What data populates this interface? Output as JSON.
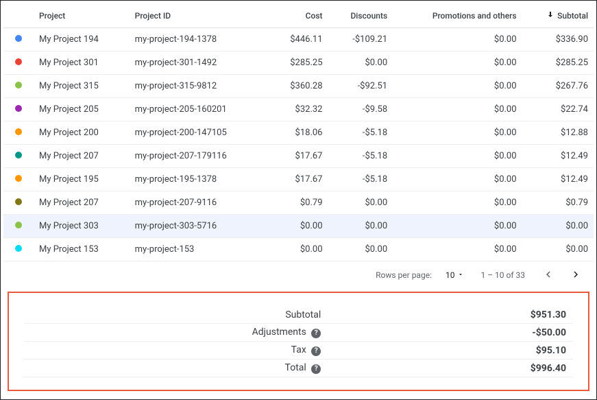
{
  "columns": {
    "project": "Project",
    "project_id": "Project ID",
    "cost": "Cost",
    "discounts": "Discounts",
    "promotions": "Promotions and others",
    "subtotal": "Subtotal"
  },
  "rows": [
    {
      "color": "#4285f4",
      "project": "My Project 194",
      "project_id": "my-project-194-1378",
      "cost": "$446.11",
      "discounts": "-$109.21",
      "promotions": "$0.00",
      "subtotal": "$336.90",
      "highlight": false
    },
    {
      "color": "#ea4335",
      "project": "My Project 301",
      "project_id": "my-project-301-1492",
      "cost": "$285.25",
      "discounts": "$0.00",
      "promotions": "$0.00",
      "subtotal": "$285.25",
      "highlight": false
    },
    {
      "color": "#8bc34a",
      "project": "My Project 315",
      "project_id": "my-project-315-9812",
      "cost": "$360.28",
      "discounts": "-$92.51",
      "promotions": "$0.00",
      "subtotal": "$267.76",
      "highlight": false
    },
    {
      "color": "#9c27b0",
      "project": "My Project 205",
      "project_id": "my-project-205-160201",
      "cost": "$32.32",
      "discounts": "-$9.58",
      "promotions": "$0.00",
      "subtotal": "$22.74",
      "highlight": false
    },
    {
      "color": "#ff9800",
      "project": "My Project 200",
      "project_id": "my-project-200-147105",
      "cost": "$18.06",
      "discounts": "-$5.18",
      "promotions": "$0.00",
      "subtotal": "$12.88",
      "highlight": false
    },
    {
      "color": "#009688",
      "project": "My Project 207",
      "project_id": "my-project-207-179116",
      "cost": "$17.67",
      "discounts": "-$5.18",
      "promotions": "$0.00",
      "subtotal": "$12.49",
      "highlight": false
    },
    {
      "color": "#ff9800",
      "project": "My Project 195",
      "project_id": "my-project-195-1378",
      "cost": "$17.67",
      "discounts": "-$5.18",
      "promotions": "$0.00",
      "subtotal": "$12.49",
      "highlight": false
    },
    {
      "color": "#827717",
      "project": "My Project 207",
      "project_id": "my-project-207-9116",
      "cost": "$0.79",
      "discounts": "$0.00",
      "promotions": "$0.00",
      "subtotal": "$0.79",
      "highlight": false
    },
    {
      "color": "#8bc34a",
      "project": "My Project 303",
      "project_id": "my-project-303-5716",
      "cost": "$0.00",
      "discounts": "$0.00",
      "promotions": "$0.00",
      "subtotal": "$0.00",
      "highlight": true
    },
    {
      "color": "#03dcf4",
      "project": "My Project 153",
      "project_id": "my-project-153",
      "cost": "$0.00",
      "discounts": "$0.00",
      "promotions": "$0.00",
      "subtotal": "$0.00",
      "highlight": false
    }
  ],
  "pagination": {
    "rows_per_page_label": "Rows per page:",
    "page_size": "10",
    "range": "1 – 10 of 33"
  },
  "summary": {
    "subtotal_label": "Subtotal",
    "subtotal_value": "$951.30",
    "adjustments_label": "Adjustments",
    "adjustments_value": "-$50.00",
    "tax_label": "Tax",
    "tax_value": "$95.10",
    "total_label": "Total",
    "total_value": "$996.40"
  }
}
